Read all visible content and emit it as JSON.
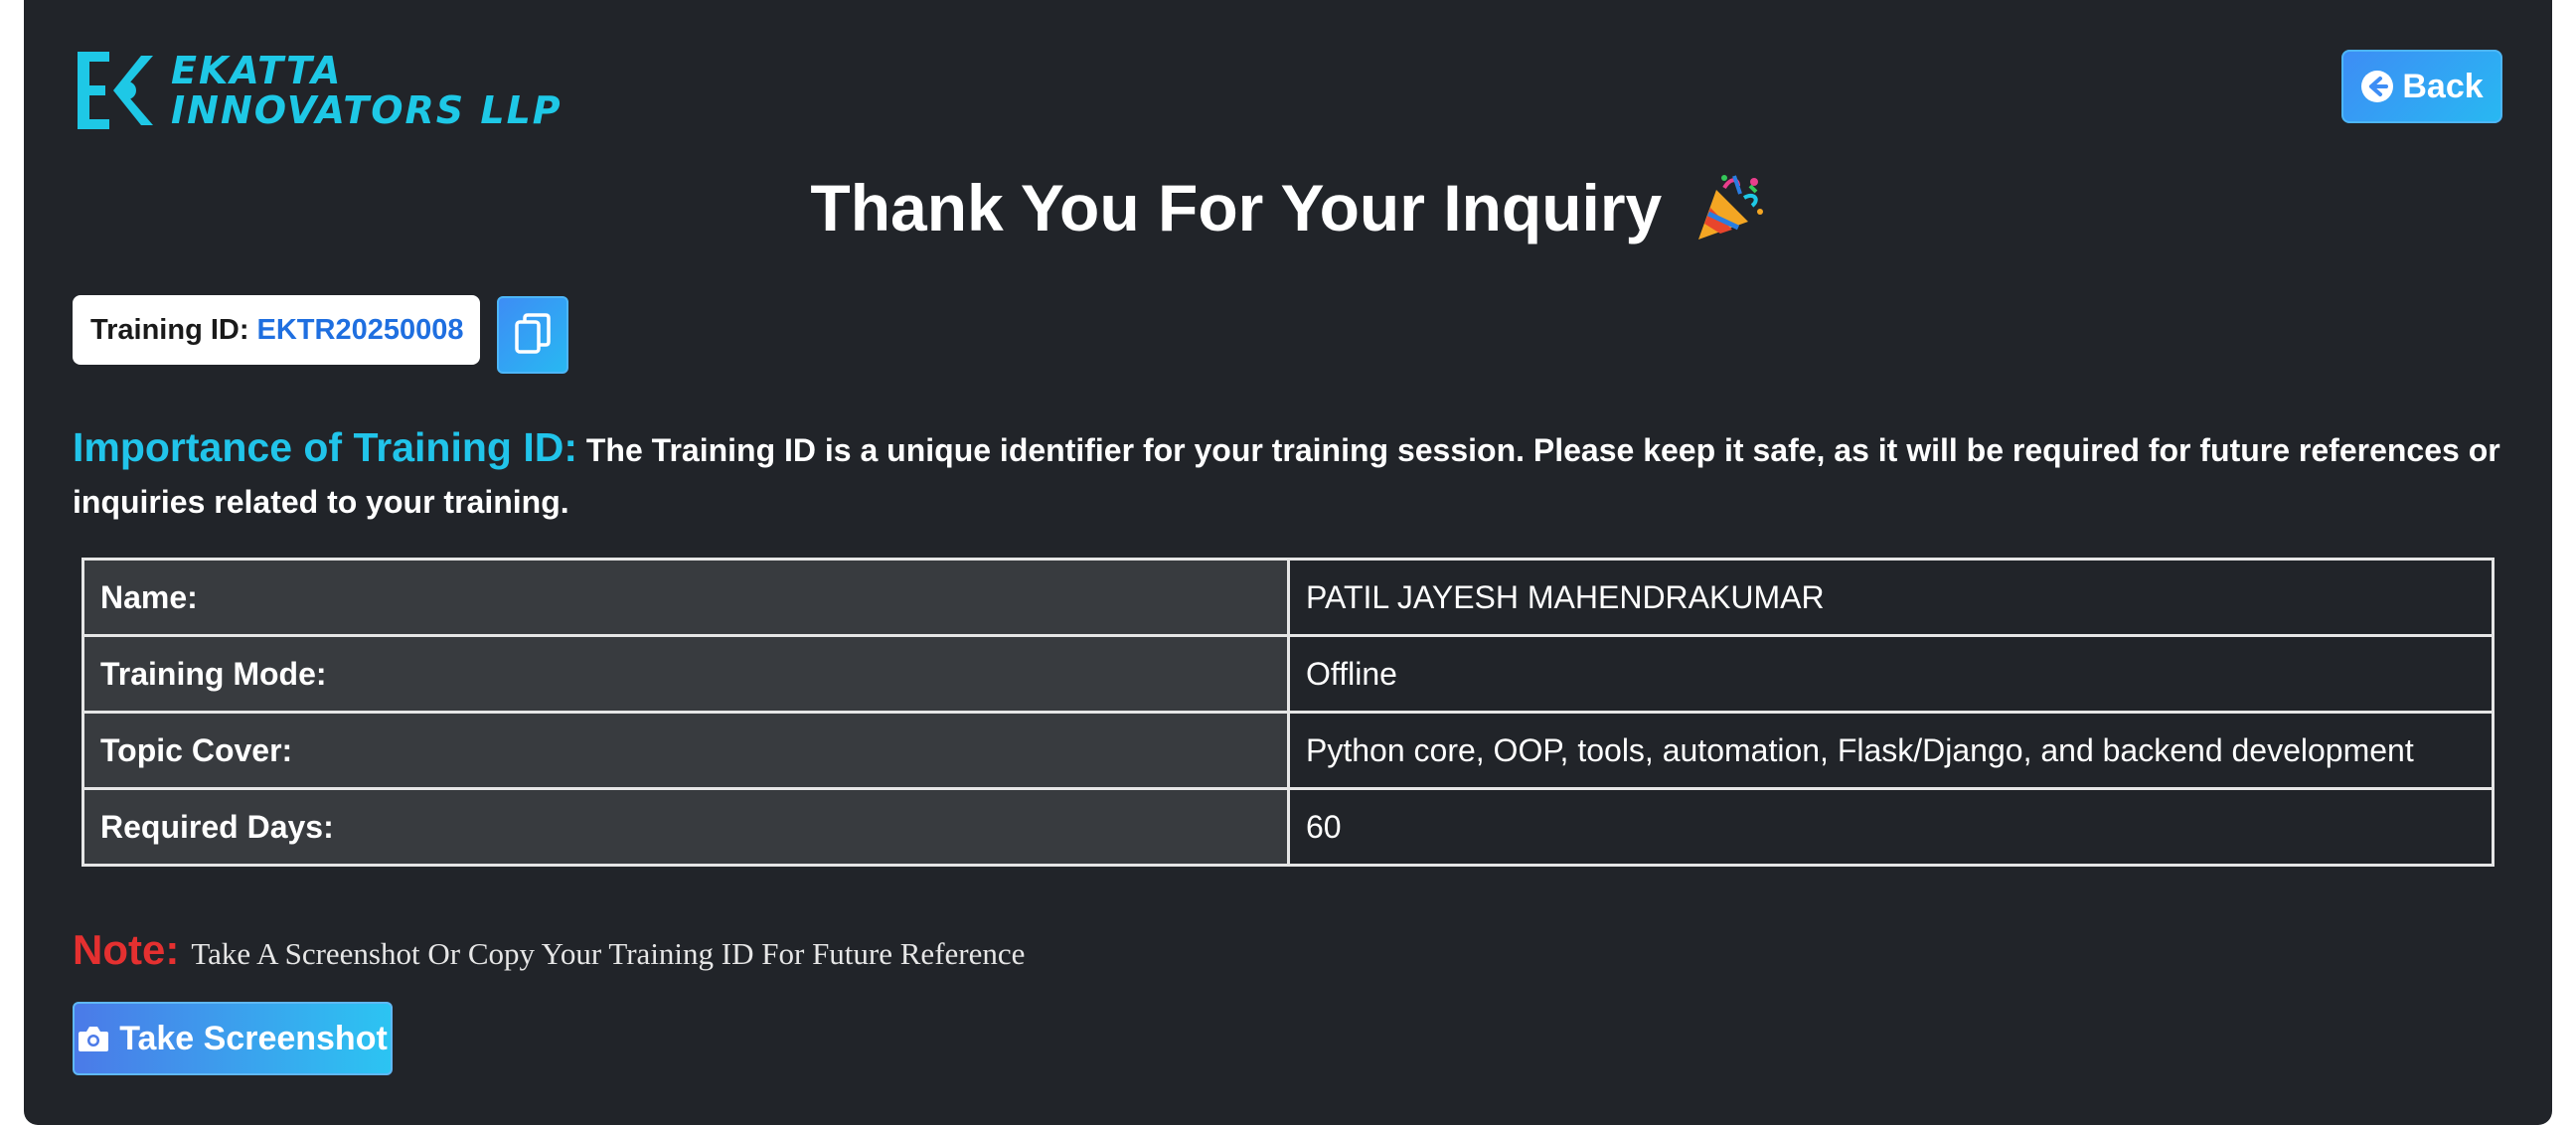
{
  "brand": {
    "logo_line1": "EKATTA",
    "logo_line2": "INNOVATORS LLP",
    "logo_color": "#1ec8e6"
  },
  "header": {
    "back_label": "Back",
    "back_icon": "arrow-left-circle-icon"
  },
  "title": {
    "text": "Thank You For Your Inquiry",
    "icon": "party-popper-icon"
  },
  "training_id": {
    "label": "Training ID:",
    "value": "EKTR20250008",
    "copy_icon": "copy-icon"
  },
  "importance": {
    "heading": "Importance of Training ID:",
    "text": "The Training ID is a unique identifier for your training session. Please keep it safe, as it will be required for future references or inquiries related to your training."
  },
  "details": [
    {
      "key": "Name:",
      "value": "PATIL JAYESH MAHENDRAKUMAR"
    },
    {
      "key": "Training Mode:",
      "value": "Offline"
    },
    {
      "key": "Topic Cover:",
      "value": "Python core, OOP, tools, automation, Flask/Django, and backend development"
    },
    {
      "key": "Required Days:",
      "value": "60"
    }
  ],
  "note": {
    "label": "Note:",
    "text": "Take A Screenshot Or Copy Your Training ID For Future Reference"
  },
  "screenshot_button": {
    "label": "Take Screenshot",
    "icon": "camera-icon"
  },
  "colors": {
    "background": "#212429",
    "accent": "#21c4ea",
    "button_gradient_start": "#3d8df5",
    "button_gradient_end": "#28b8f2",
    "note_red": "#e53030",
    "id_blue": "#1f6fe0"
  }
}
